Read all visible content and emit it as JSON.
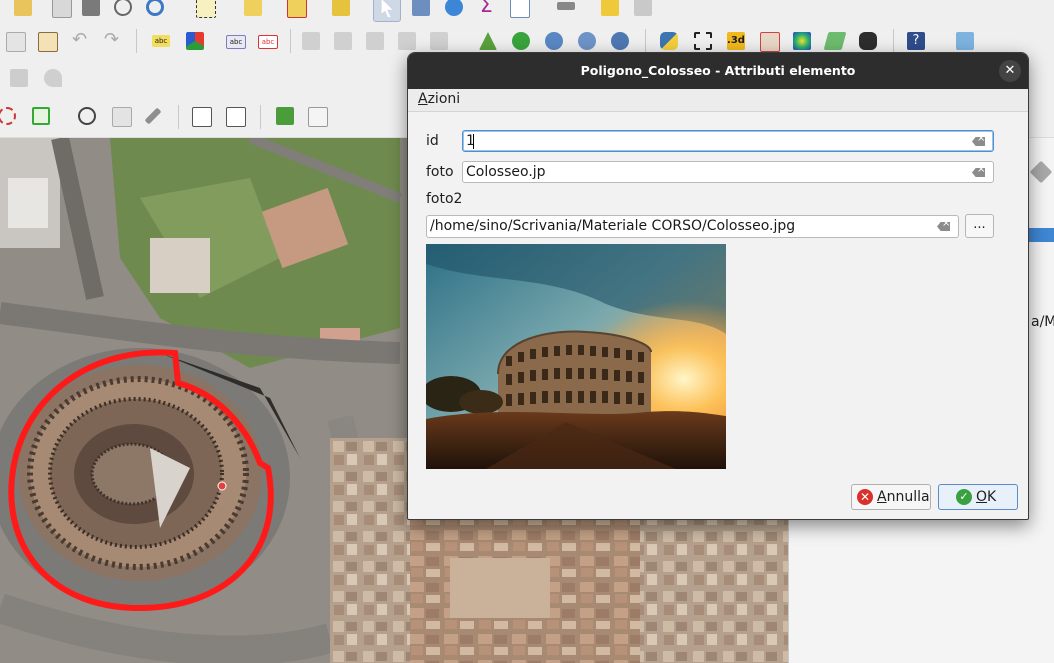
{
  "dialog": {
    "title": "Poligono_Colosseo - Attributi elemento",
    "close_glyph": "✕",
    "menu": {
      "azioni_first": "A",
      "azioni_rest": "zioni"
    },
    "fields": {
      "id": {
        "label": "id",
        "value": "1"
      },
      "foto": {
        "label": "foto",
        "value": "Colosseo.jp"
      },
      "foto2": {
        "label": "foto2",
        "value": "/home/sino/Scrivania/Materiale CORSO/Colosseo.jpg",
        "browse_label": "..."
      }
    },
    "buttons": {
      "cancel": {
        "label_first": "A",
        "label_rest": "nnulla",
        "icon": "cancel-icon"
      },
      "ok": {
        "label_first": "O",
        "label_rest": "K",
        "icon": "check-icon"
      }
    }
  },
  "dock": {
    "partial_text": "a/M"
  },
  "toolbar": {
    "labels": {
      "abc": "abc",
      "threed": ".3d"
    }
  },
  "colors": {
    "selection_polygon": "#ff1a1a",
    "titlebar": "#2d2d2d",
    "accent": "#3f86d3"
  }
}
